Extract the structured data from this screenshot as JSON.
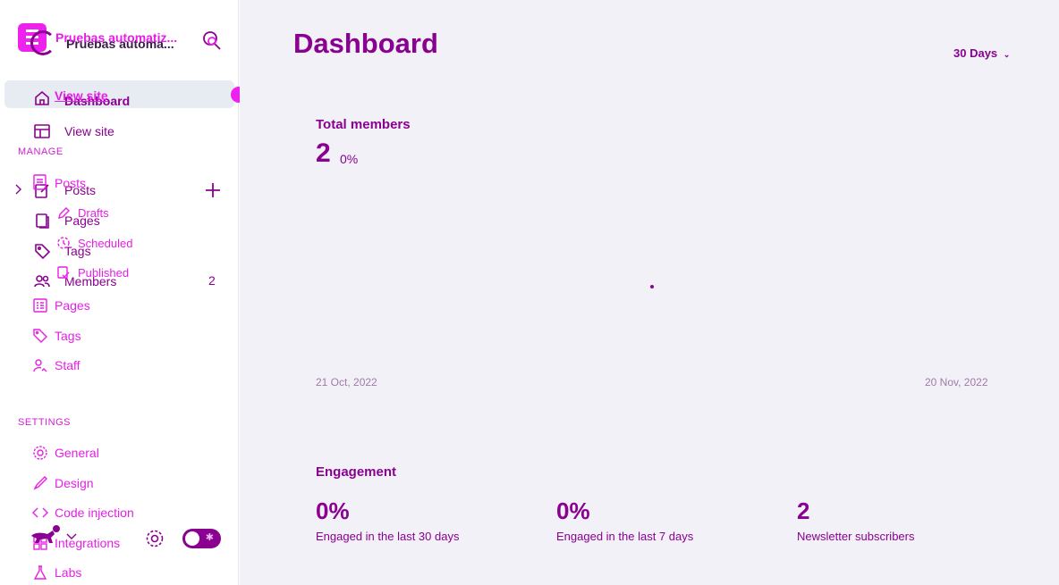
{
  "sidebar": {
    "site_title_front": "Pruebas automatiz...",
    "site_title_back": "Pruebas automa...",
    "nav_back": {
      "dashboard": "Dashboard",
      "view_site": "View site",
      "posts": "Posts",
      "pages": "Pages",
      "tags": "Tags",
      "members": "Members",
      "members_count": "2"
    },
    "nav_front": {
      "view_site": "View site",
      "posts": "Posts",
      "drafts": "Drafts",
      "scheduled": "Scheduled",
      "published": "Published",
      "pages": "Pages",
      "tags": "Tags",
      "staff": "Staff"
    },
    "manage_title": "MANAGE",
    "settings_title": "SETTINGS",
    "settings_items": {
      "general": "General",
      "design": "Design",
      "code_injection": "Code injection",
      "integrations": "Integrations",
      "labs": "Labs"
    }
  },
  "main": {
    "title": "Dashboard",
    "range": "30 Days",
    "members": {
      "title": "Total members",
      "value": "2",
      "change": "0%",
      "start_date": "21 Oct, 2022",
      "end_date": "20 Nov, 2022"
    },
    "engagement": {
      "title": "Engagement",
      "stats": [
        {
          "value": "0%",
          "label": "Engaged in the last 30 days"
        },
        {
          "value": "0%",
          "label": "Engaged in the last 7 days"
        },
        {
          "value": "2",
          "label": "Newsletter subscribers"
        }
      ]
    }
  },
  "colors": {
    "accent": "#8a0090",
    "magenta": "#e61fe6",
    "main_bg": "#f1f1f7"
  }
}
